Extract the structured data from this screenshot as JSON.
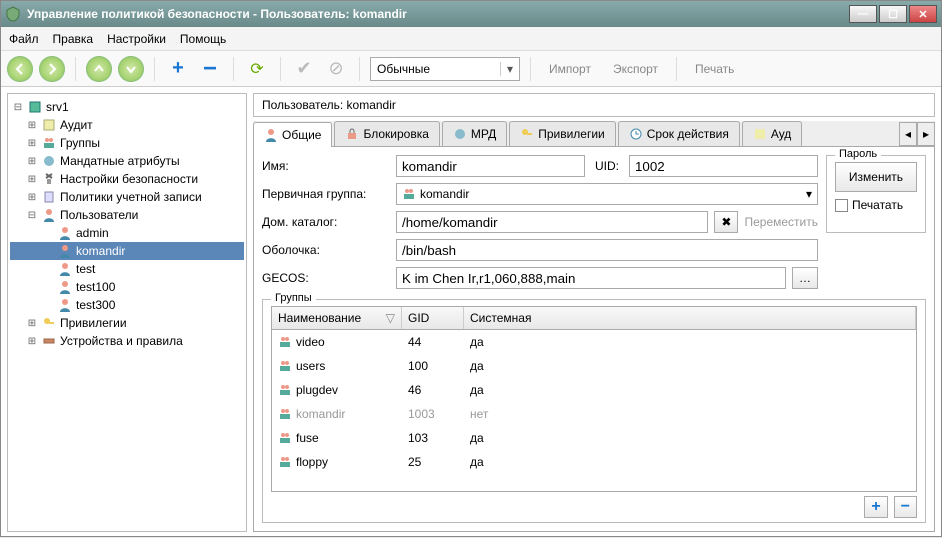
{
  "window": {
    "title": "Управление политикой безопасности - Пользователь: komandir"
  },
  "menu": {
    "file": "Файл",
    "edit": "Правка",
    "settings": "Настройки",
    "help": "Помощь"
  },
  "toolbar": {
    "combo": "Обычные",
    "import": "Импорт",
    "export": "Экспорт",
    "print": "Печать"
  },
  "tree": {
    "root": "srv1",
    "items": [
      {
        "label": "Аудит"
      },
      {
        "label": "Группы"
      },
      {
        "label": "Мандатные атрибуты"
      },
      {
        "label": "Настройки безопасности"
      },
      {
        "label": "Политики учетной записи"
      },
      {
        "label": "Пользователи",
        "expanded": true,
        "children": [
          {
            "label": "admin"
          },
          {
            "label": "komandir",
            "selected": true
          },
          {
            "label": "test"
          },
          {
            "label": "test100"
          },
          {
            "label": "test300"
          }
        ]
      },
      {
        "label": "Привилегии"
      },
      {
        "label": "Устройства и правила"
      }
    ]
  },
  "header": {
    "userLabel": "Пользователь: komandir"
  },
  "tabs": {
    "general": "Общие",
    "lock": "Блокировка",
    "mrd": "МРД",
    "priv": "Привилегии",
    "expiry": "Срок действия",
    "aud": "Ауд"
  },
  "form": {
    "nameLabel": "Имя:",
    "nameValue": "komandir",
    "uidLabel": "UID:",
    "uidValue": "1002",
    "primaryGroupLabel": "Первичная группа:",
    "primaryGroupValue": "komandir",
    "passwordLegend": "Пароль",
    "changeBtn": "Изменить",
    "printCheck": "Печатать",
    "homeLabel": "Дом. каталог:",
    "homeValue": "/home/komandir",
    "moveBtn": "Переместить",
    "shellLabel": "Оболочка:",
    "shellValue": "/bin/bash",
    "gecosLabel": "GECOS:",
    "gecosValue": "K im Chen Ir,r1,060,888,main"
  },
  "groups": {
    "legend": "Группы",
    "cols": {
      "name": "Наименование",
      "gid": "GID",
      "system": "Системная"
    },
    "rows": [
      {
        "name": "video",
        "gid": "44",
        "system": "да"
      },
      {
        "name": "users",
        "gid": "100",
        "system": "да"
      },
      {
        "name": "plugdev",
        "gid": "46",
        "system": "да"
      },
      {
        "name": "komandir",
        "gid": "1003",
        "system": "нет",
        "disabled": true
      },
      {
        "name": "fuse",
        "gid": "103",
        "system": "да"
      },
      {
        "name": "floppy",
        "gid": "25",
        "system": "да"
      }
    ]
  }
}
